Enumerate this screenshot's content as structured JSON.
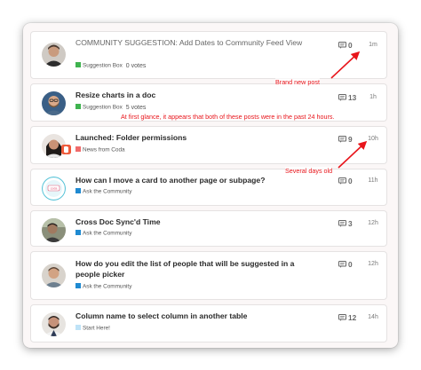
{
  "posts": [
    {
      "title": "COMMUNITY SUGGESTION: Add Dates to Community Feed View",
      "category": "Suggestion Box",
      "category_color": "#3fb34f",
      "votes": "0 votes",
      "comments": "0",
      "age": "1m",
      "avatar": "man-dark-shirt"
    },
    {
      "title": "Resize charts in a doc",
      "category": "Suggestion Box",
      "category_color": "#3fb34f",
      "votes": "5 votes",
      "comments": "13",
      "age": "1h",
      "avatar": "man-glasses-beard"
    },
    {
      "title": "Launched: Folder permissions",
      "category": "News from Coda",
      "category_color": "#f06b6b",
      "votes": "",
      "comments": "9",
      "age": "10h",
      "avatar": "woman-dark-hair"
    },
    {
      "title": "How can I move a card to another page or subpage?",
      "category": "Ask the Community",
      "category_color": "#1f8ad1",
      "votes": "",
      "comments": "0",
      "age": "11h",
      "avatar": "logo-badge"
    },
    {
      "title": "Cross Doc Sync'd Time",
      "category": "Ask the Community",
      "category_color": "#1f8ad1",
      "votes": "",
      "comments": "3",
      "age": "12h",
      "avatar": "man-outdoor"
    },
    {
      "title": "How do you edit the list of people that will be suggested in a people picker",
      "category": "Ask the Community",
      "category_color": "#1f8ad1",
      "votes": "",
      "comments": "0",
      "age": "12h",
      "avatar": "man-smiling"
    },
    {
      "title": "Column name to select column in another table",
      "category": "Start Here!",
      "category_color": "#bfe3f7",
      "votes": "",
      "comments": "12",
      "age": "14h",
      "avatar": "man-beard-portrait"
    }
  ],
  "annotations": {
    "brand_new": "Brand new post",
    "first_glance": "At first glance, it appears that both of these posts were in the past 24 hours.",
    "several_days": "Several days old"
  },
  "colors": {
    "annotation": "#e8151b",
    "panel_bg": "#fbf7f7"
  }
}
